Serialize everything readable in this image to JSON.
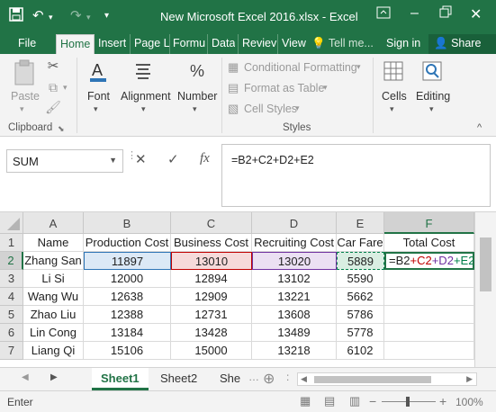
{
  "window": {
    "title": "New Microsoft Excel 2016.xlsx - Excel"
  },
  "tabs": [
    {
      "label": "File"
    },
    {
      "label": "Home"
    },
    {
      "label": "Insert"
    },
    {
      "label": "Page L"
    },
    {
      "label": "Formu"
    },
    {
      "label": "Data"
    },
    {
      "label": "Reviev"
    },
    {
      "label": "View"
    },
    {
      "label": "Tell me..."
    },
    {
      "label": "Sign in"
    },
    {
      "label": "Share"
    }
  ],
  "ribbon": {
    "paste": "Paste",
    "font": "Font",
    "alignment": "Alignment",
    "number": "Number",
    "conditional_formatting": "Conditional Formatting",
    "format_as_table": "Format as Table",
    "cell_styles": "Cell Styles",
    "cells": "Cells",
    "editing": "Editing",
    "group_clipboard": "Clipboard",
    "group_styles": "Styles"
  },
  "formula_bar": {
    "name_box": "SUM",
    "fx": "fx",
    "formula": "=B2+C2+D2+E2"
  },
  "columns": [
    "A",
    "B",
    "C",
    "D",
    "E",
    "F"
  ],
  "rows": [
    {
      "num": "1",
      "cells": [
        "Name",
        "Production Cost",
        "Business Cost",
        "Recruiting Cost",
        "Car Fare",
        "Total Cost"
      ]
    },
    {
      "num": "2",
      "cells": [
        "Zhang San",
        "11897",
        "13010",
        "13020",
        "5889",
        ""
      ]
    },
    {
      "num": "3",
      "cells": [
        "Li Si",
        "12000",
        "12894",
        "13102",
        "5590",
        ""
      ]
    },
    {
      "num": "4",
      "cells": [
        "Wang Wu",
        "12638",
        "12909",
        "13221",
        "5662",
        ""
      ]
    },
    {
      "num": "5",
      "cells": [
        "Zhao Liu",
        "12388",
        "12731",
        "13608",
        "5786",
        ""
      ]
    },
    {
      "num": "6",
      "cells": [
        "Lin Cong",
        "13184",
        "13428",
        "13489",
        "5778",
        ""
      ]
    },
    {
      "num": "7",
      "cells": [
        "Liang Qi",
        "15106",
        "15000",
        "13218",
        "6102",
        ""
      ]
    }
  ],
  "editing_cell": {
    "parts": [
      "=B2",
      "+C2",
      "+D2",
      "+E2"
    ]
  },
  "sheets": [
    "Sheet1",
    "Sheet2",
    "She"
  ],
  "status": {
    "mode": "Enter",
    "zoom": "100%",
    "zoom_minus": "−",
    "zoom_plus": "+"
  },
  "colors": {
    "brand": "#217346",
    "ref_b": "#2e75b6",
    "ref_c": "#c00000",
    "ref_d": "#7030a0",
    "ref_e": "#00804a"
  }
}
